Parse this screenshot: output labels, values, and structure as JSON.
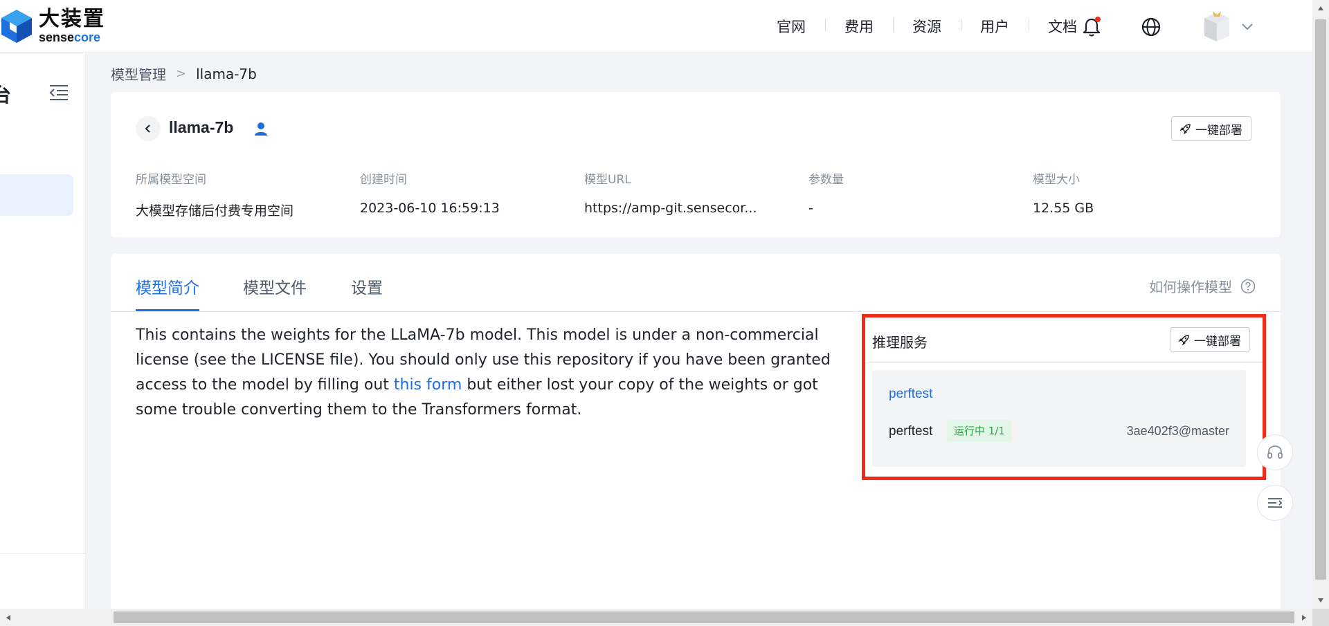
{
  "logo": {
    "cn": "大装置",
    "en_a": "sense",
    "en_b": "core"
  },
  "nav": {
    "items": [
      "官网",
      "费用",
      "资源",
      "用户",
      "文档"
    ]
  },
  "sidebar": {
    "title": "台"
  },
  "breadcrumb": {
    "parent": "模型管理",
    "separator": ">",
    "current": "llama-7b"
  },
  "model": {
    "name": "llama-7b",
    "deploy_label": "一键部署",
    "fields": [
      {
        "label": "所属模型空间",
        "value": "大模型存储后付费专用空间"
      },
      {
        "label": "创建时间",
        "value": "2023-06-10 16:59:13"
      },
      {
        "label": "模型URL",
        "value": "https://amp-git.sensecor..."
      },
      {
        "label": "参数量",
        "value": "-"
      },
      {
        "label": "模型大小",
        "value": "12.55 GB"
      }
    ]
  },
  "tabs": [
    {
      "label": "模型简介",
      "active": true
    },
    {
      "label": "模型文件",
      "active": false
    },
    {
      "label": "设置",
      "active": false
    }
  ],
  "help": {
    "label": "如何操作模型"
  },
  "readme": {
    "before_link": "This contains the weights for the LLaMA-7b model. This model is under a non-commercial license (see the LICENSE file). You should only use this repository if you have been granted access to the model by filling out ",
    "link_text": "this form",
    "after_link": " but either lost your copy of the weights or got some trouble converting them to the Transformers format."
  },
  "inference": {
    "title": "推理服务",
    "deploy_label": "一键部署",
    "service": {
      "link": "perftest",
      "name": "perftest",
      "status": "运行中 1/1",
      "ref": "3ae402f3@master"
    }
  },
  "colors": {
    "accent": "#1e6fe0",
    "highlight": "#ee2a19",
    "status_green": "#28a745"
  }
}
